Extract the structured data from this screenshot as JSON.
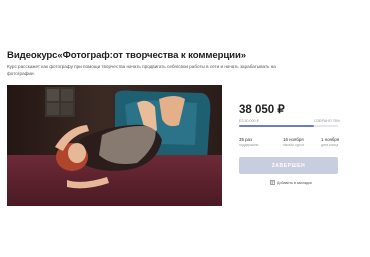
{
  "course": {
    "title": "Видеокурс«Фотограф:от творчества к коммерции»",
    "description": "Курс расскажет как фотографу при помощи творчества начать продвигать себя/свои работы в сети и начать зарабатывать на фотографии."
  },
  "photo": {
    "alt_icon": "course-cover-photo"
  },
  "pricing": {
    "price": "38 050 ₽",
    "progress_left_label": "ЕЗ 50 000 ₽",
    "progress_right_label": "СОБРАНО 76%",
    "progress_fraction": 0.76
  },
  "stats": [
    {
      "value": "35 раз",
      "label": "поддержали"
    },
    {
      "value": "16 ноября",
      "label": "начало курса"
    },
    {
      "value": "1 ноября",
      "label": "дата конца"
    }
  ],
  "status_button_label": "ЗАВЕРШЕН",
  "bookmark_label": "Добавить в закладки"
}
